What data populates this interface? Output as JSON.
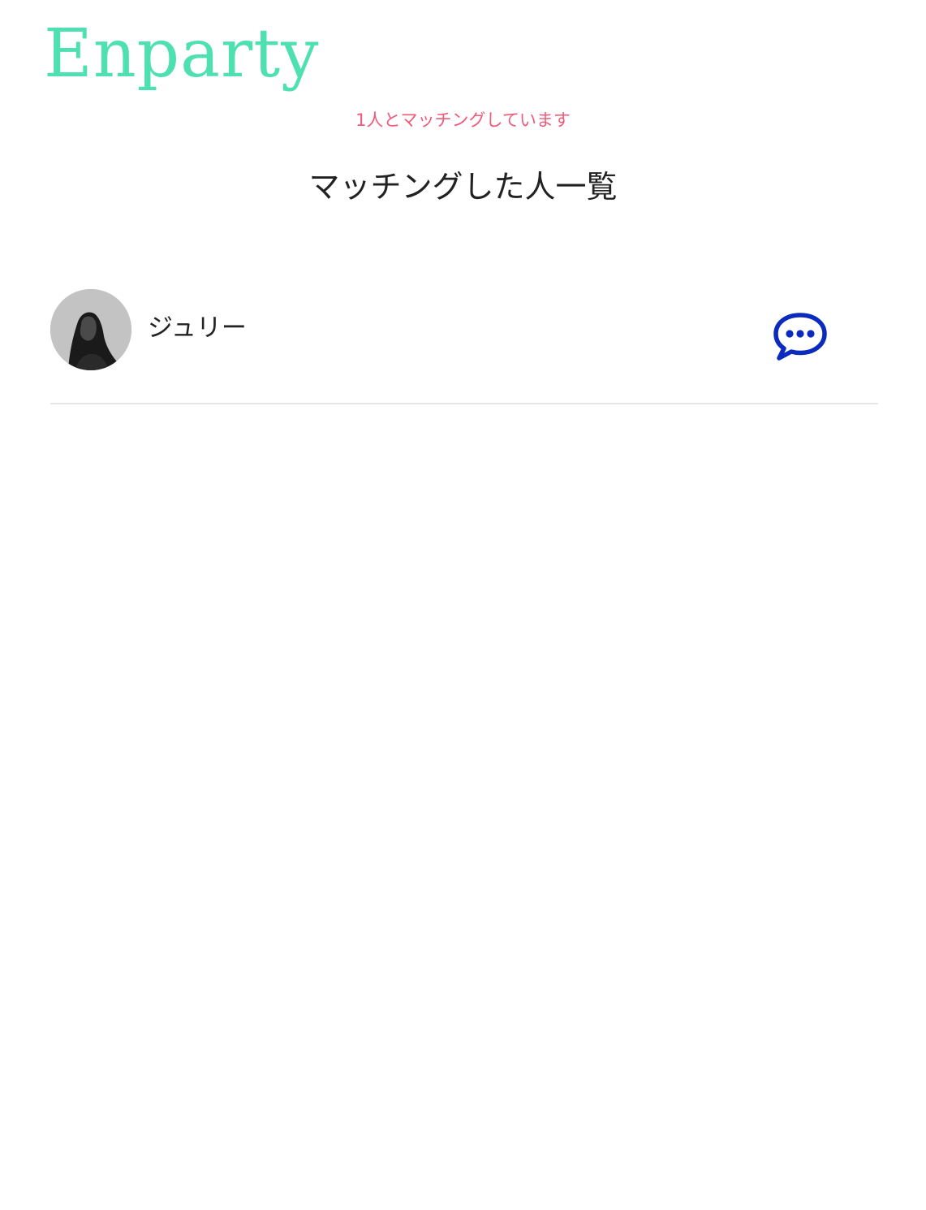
{
  "app": {
    "logo_text": "Enparty",
    "colors": {
      "logo": "#4ee0b0",
      "match_count": "#ef5a7a",
      "chat_icon": "#0a2bbd"
    }
  },
  "header": {
    "match_count_text": "1人とマッチングしています"
  },
  "main": {
    "title": "マッチングした人一覧",
    "matches": [
      {
        "name": "ジュリー",
        "avatar_icon": "user-photo",
        "action_icon": "chat-bubble-icon"
      }
    ]
  }
}
